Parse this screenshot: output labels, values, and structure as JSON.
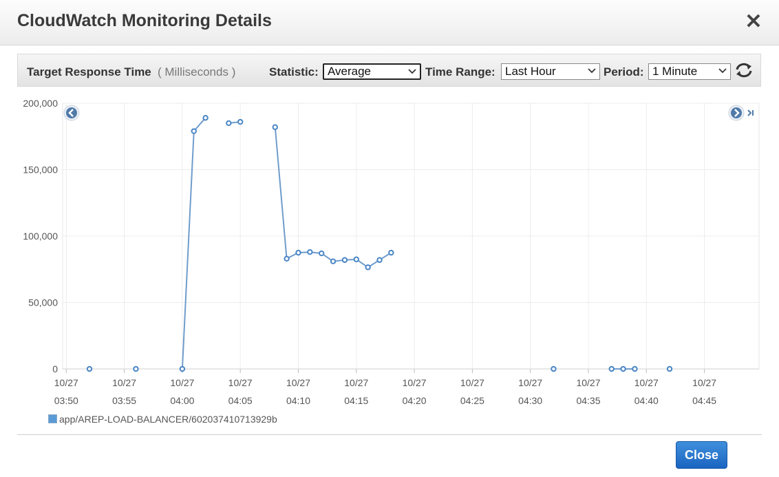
{
  "dialog": {
    "title": "CloudWatch Monitoring Details",
    "close_icon": "close-icon"
  },
  "toolbar": {
    "metric_name": "Target Response Time",
    "metric_unit": "( Milliseconds )",
    "statistic_label": "Statistic:",
    "statistic_value": "Average",
    "time_range_label": "Time Range:",
    "time_range_value": "Last Hour",
    "period_label": "Period:",
    "period_value": "1 Minute",
    "refresh_icon": "refresh-icon"
  },
  "chart_data": {
    "type": "line",
    "title": "",
    "xlabel": "",
    "ylabel": "",
    "ylim": [
      0,
      200000
    ],
    "y_ticks": [
      "200,000",
      "150,000",
      "100,000",
      "50,000",
      "0"
    ],
    "y_tick_values": [
      200000,
      150000,
      100000,
      50000,
      0
    ],
    "x_ticks": [
      {
        "date": "10/27",
        "time": "03:50"
      },
      {
        "date": "10/27",
        "time": "03:55"
      },
      {
        "date": "10/27",
        "time": "04:00"
      },
      {
        "date": "10/27",
        "time": "04:05"
      },
      {
        "date": "10/27",
        "time": "04:10"
      },
      {
        "date": "10/27",
        "time": "04:15"
      },
      {
        "date": "10/27",
        "time": "04:20"
      },
      {
        "date": "10/27",
        "time": "04:25"
      },
      {
        "date": "10/27",
        "time": "04:30"
      },
      {
        "date": "10/27",
        "time": "04:35"
      },
      {
        "date": "10/27",
        "time": "04:40"
      },
      {
        "date": "10/27",
        "time": "04:45"
      }
    ],
    "grid": true,
    "series": [
      {
        "name": "app/AREP-LOAD-BALANCER/602037410713929b",
        "color": "#5b9bd5",
        "segments": [
          [
            [
              "03:52",
              0
            ]
          ],
          [
            [
              "03:56",
              0
            ]
          ],
          [
            [
              "04:00",
              0
            ],
            [
              "04:01",
              179000
            ],
            [
              "04:02",
              189000
            ]
          ],
          [
            [
              "04:04",
              185000
            ],
            [
              "04:05",
              186000
            ]
          ],
          [
            [
              "04:08",
              182000
            ],
            [
              "04:09",
              83000
            ],
            [
              "04:10",
              87500
            ],
            [
              "04:11",
              88000
            ],
            [
              "04:12",
              87000
            ],
            [
              "04:13",
              81000
            ],
            [
              "04:14",
              82000
            ],
            [
              "04:15",
              82500
            ],
            [
              "04:16",
              76500
            ],
            [
              "04:17",
              82000
            ],
            [
              "04:18",
              87500
            ]
          ],
          [
            [
              "04:32",
              0
            ]
          ],
          [
            [
              "04:37",
              0
            ],
            [
              "04:38",
              0
            ],
            [
              "04:39",
              0
            ]
          ],
          [
            [
              "04:42",
              0
            ]
          ]
        ]
      }
    ],
    "nav_prev_icon": "chevron-left-circle-icon",
    "nav_next_icon": "chevron-right-circle-icon",
    "nav_end_icon": "skip-to-end-icon"
  },
  "legend": {
    "label": "app/AREP-LOAD-BALANCER/602037410713929b"
  },
  "footer": {
    "close_label": "Close"
  }
}
